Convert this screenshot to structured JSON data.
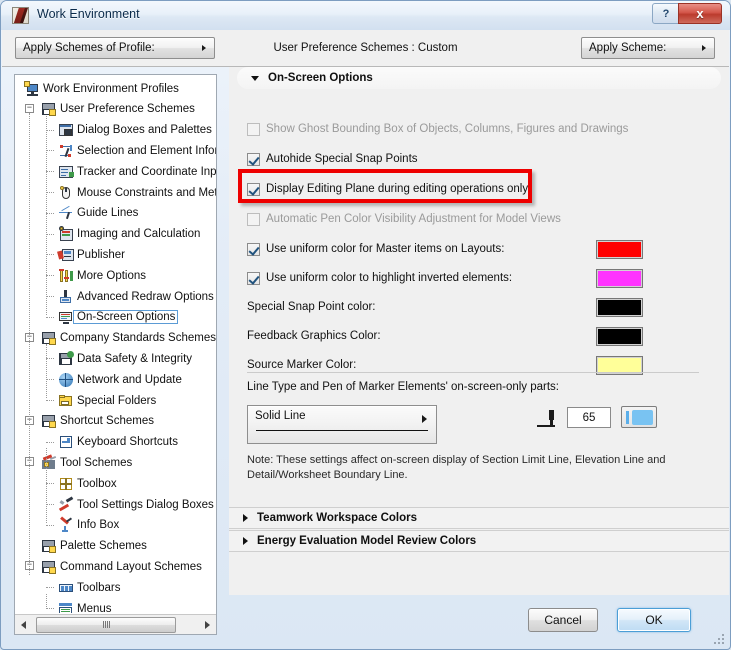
{
  "window": {
    "title": "Work Environment",
    "icon": "app-icon",
    "help_label": "?",
    "close_label": "x"
  },
  "toolbar": {
    "apply_profile_label": "Apply Schemes of Profile:",
    "preference_label": "User Preference Schemes : Custom",
    "apply_scheme_label": "Apply Scheme:"
  },
  "tree": {
    "items": [
      {
        "label": "Work Environment Profiles",
        "depth": 0,
        "icon": "profiles-icon",
        "expander": "",
        "selected": false
      },
      {
        "label": "User Preference Schemes",
        "depth": 1,
        "icon": "user-pref-icon",
        "expander": "minus",
        "selected": false
      },
      {
        "label": "Dialog Boxes and Palettes",
        "depth": 2,
        "icon": "dialog-boxes-icon",
        "expander": "",
        "selected": false
      },
      {
        "label": "Selection and Element Inform",
        "depth": 2,
        "icon": "selection-icon",
        "expander": "",
        "selected": false
      },
      {
        "label": "Tracker and Coordinate Inpu",
        "depth": 2,
        "icon": "tracker-icon",
        "expander": "",
        "selected": false
      },
      {
        "label": "Mouse Constraints and Meth",
        "depth": 2,
        "icon": "mouse-icon",
        "expander": "",
        "selected": false
      },
      {
        "label": "Guide Lines",
        "depth": 2,
        "icon": "guide-lines-icon",
        "expander": "",
        "selected": false
      },
      {
        "label": "Imaging and Calculation",
        "depth": 2,
        "icon": "imaging-icon",
        "expander": "",
        "selected": false
      },
      {
        "label": "Publisher",
        "depth": 2,
        "icon": "publisher-icon",
        "expander": "",
        "selected": false
      },
      {
        "label": "More Options",
        "depth": 2,
        "icon": "more-options-icon",
        "expander": "",
        "selected": false
      },
      {
        "label": "Advanced Redraw Options",
        "depth": 2,
        "icon": "redraw-icon",
        "expander": "",
        "selected": false
      },
      {
        "label": "On-Screen Options",
        "depth": 2,
        "icon": "on-screen-icon",
        "expander": "",
        "selected": true
      },
      {
        "label": "Company Standards Schemes",
        "depth": 1,
        "icon": "company-standards-icon",
        "expander": "minus",
        "selected": false
      },
      {
        "label": "Data Safety & Integrity",
        "depth": 2,
        "icon": "data-safety-icon",
        "expander": "",
        "selected": false
      },
      {
        "label": "Network and Update",
        "depth": 2,
        "icon": "network-icon",
        "expander": "",
        "selected": false
      },
      {
        "label": "Special Folders",
        "depth": 2,
        "icon": "folders-icon",
        "expander": "",
        "selected": false
      },
      {
        "label": "Shortcut Schemes",
        "depth": 1,
        "icon": "shortcut-schemes-icon",
        "expander": "minus",
        "selected": false
      },
      {
        "label": "Keyboard Shortcuts",
        "depth": 2,
        "icon": "keyboard-icon",
        "expander": "",
        "selected": false
      },
      {
        "label": "Tool Schemes",
        "depth": 1,
        "icon": "tool-schemes-icon",
        "expander": "minus",
        "selected": false
      },
      {
        "label": "Toolbox",
        "depth": 2,
        "icon": "toolbox-icon",
        "expander": "",
        "selected": false
      },
      {
        "label": "Tool Settings Dialog Boxes",
        "depth": 2,
        "icon": "tool-settings-icon",
        "expander": "",
        "selected": false
      },
      {
        "label": "Info Box",
        "depth": 2,
        "icon": "info-box-icon",
        "expander": "",
        "selected": false
      },
      {
        "label": "Palette Schemes",
        "depth": 1,
        "icon": "palette-schemes-icon",
        "expander": "",
        "selected": false
      },
      {
        "label": "Command Layout Schemes",
        "depth": 1,
        "icon": "command-layout-icon",
        "expander": "minus",
        "selected": false
      },
      {
        "label": "Toolbars",
        "depth": 2,
        "icon": "toolbars-icon",
        "expander": "",
        "selected": false
      },
      {
        "label": "Menus",
        "depth": 2,
        "icon": "menus-icon",
        "expander": "",
        "selected": false
      }
    ]
  },
  "main": {
    "section_title": "On-Screen Options",
    "checkboxes": [
      {
        "label": "Show Ghost Bounding Box of Objects, Columns, Figures and Drawings",
        "checked": false,
        "enabled": false
      },
      {
        "label": "Autohide Special Snap Points",
        "checked": true,
        "enabled": true
      },
      {
        "label": "Display Editing Plane during editing operations only",
        "checked": true,
        "enabled": true,
        "highlighted": true
      },
      {
        "label": "Automatic Pen Color Visibility Adjustment for Model Views",
        "checked": false,
        "enabled": false
      }
    ],
    "color_rows": [
      {
        "label": "Use uniform color for Master items on Layouts:",
        "has_checkbox": true,
        "checked": true,
        "color": "#FF0000"
      },
      {
        "label": "Use uniform color to highlight inverted elements:",
        "has_checkbox": true,
        "checked": true,
        "color": "#FF33FF"
      },
      {
        "label": "Special Snap Point color:",
        "has_checkbox": false,
        "checked": false,
        "color": "#000000"
      },
      {
        "label": "Feedback Graphics Color:",
        "has_checkbox": false,
        "checked": false,
        "color": "#000000"
      },
      {
        "label": "Source Marker Color:",
        "has_checkbox": false,
        "checked": false,
        "color": "#FFFF99"
      }
    ],
    "linetype_label": "Line Type and Pen of Marker Elements' on-screen-only parts:",
    "linetype_value": "Solid Line",
    "pen_value": "65",
    "pen_color": "#79C3F2",
    "note": "Note: These settings affect on-screen display of Section Limit Line, Elevation Line and Detail/Worksheet Boundary Line.",
    "collapsed_sections": [
      {
        "label": "Teamwork Workspace Colors"
      },
      {
        "label": "Energy Evaluation Model Review Colors"
      }
    ]
  },
  "footer": {
    "cancel_label": "Cancel",
    "ok_label": "OK"
  },
  "colors": {
    "highlight_outline": "#EE0000",
    "selection_outline": "#5B9BD5",
    "titlebar_text": "#0A2A4A"
  }
}
